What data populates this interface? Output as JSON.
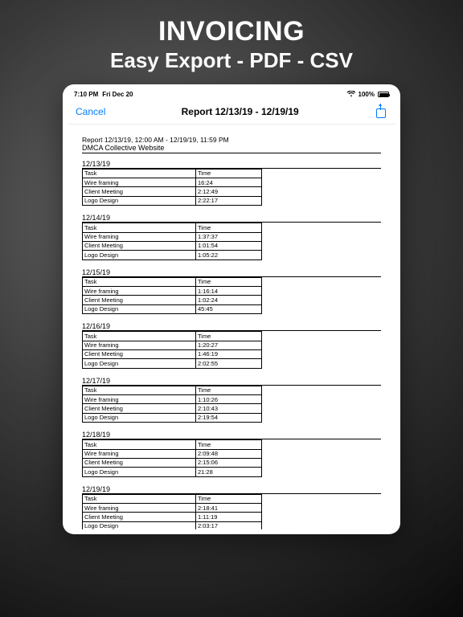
{
  "hero": {
    "title": "INVOICING",
    "subtitle": "Easy Export - PDF - CSV"
  },
  "status_bar": {
    "time": "7:10 PM",
    "date": "Fri Dec 20",
    "wifi_icon": "wifi",
    "battery_pct": "100%"
  },
  "nav": {
    "cancel": "Cancel",
    "title": "Report 12/13/19 - 12/19/19",
    "share_icon": "share"
  },
  "report": {
    "header": "Report 12/13/19, 12:00 AM - 12/19/19, 11:59 PM",
    "project": "DMCA Collective Website",
    "task_col": "Task",
    "time_col": "Time",
    "days": [
      {
        "date": "12/13/19",
        "rows": [
          {
            "task": "Wire framing",
            "time": "16:24"
          },
          {
            "task": "Client Meeting",
            "time": "2:12:49"
          },
          {
            "task": "Logo Design",
            "time": "2:22:17"
          }
        ]
      },
      {
        "date": "12/14/19",
        "rows": [
          {
            "task": "Wire framing",
            "time": "1:37:37"
          },
          {
            "task": "Client Meeting",
            "time": "1:01:54"
          },
          {
            "task": "Logo Design",
            "time": "1:05:22"
          }
        ]
      },
      {
        "date": "12/15/19",
        "rows": [
          {
            "task": "Wire framing",
            "time": "1:16:14"
          },
          {
            "task": "Client Meeting",
            "time": "1:02:24"
          },
          {
            "task": "Logo Design",
            "time": "45:45"
          }
        ]
      },
      {
        "date": "12/16/19",
        "rows": [
          {
            "task": "Wire framing",
            "time": "1:20:27"
          },
          {
            "task": "Client Meeting",
            "time": "1:46:19"
          },
          {
            "task": "Logo Design",
            "time": "2:02:55"
          }
        ]
      },
      {
        "date": "12/17/19",
        "rows": [
          {
            "task": "Wire framing",
            "time": "1:10:26"
          },
          {
            "task": "Client Meeting",
            "time": "2:10:43"
          },
          {
            "task": "Logo Design",
            "time": "2:19:54"
          }
        ]
      },
      {
        "date": "12/18/19",
        "rows": [
          {
            "task": "Wire framing",
            "time": "2:09:48"
          },
          {
            "task": "Client Meeting",
            "time": "2:15:06"
          },
          {
            "task": "Logo Design",
            "time": "21:28"
          }
        ]
      },
      {
        "date": "12/19/19",
        "rows": [
          {
            "task": "Wire framing",
            "time": "2:18:41"
          },
          {
            "task": "Client Meeting",
            "time": "1:11:19"
          },
          {
            "task": "Logo Design",
            "time": "2:03:17"
          }
        ]
      }
    ]
  }
}
